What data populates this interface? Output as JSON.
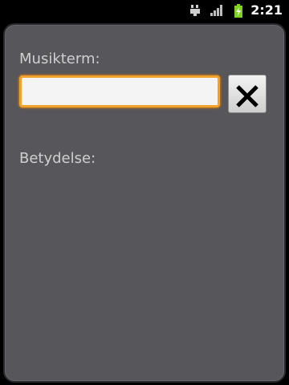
{
  "status_bar": {
    "time": "2:21",
    "icons": [
      "usb-debug-icon",
      "signal-icon",
      "battery-charging-icon"
    ]
  },
  "form": {
    "term_label": "Musikterm:",
    "term_value": "",
    "clear_icon": "close-icon",
    "meaning_label": "Betydelse:"
  },
  "colors": {
    "panel_bg": "#57565a",
    "input_focus_border": "#f0a22a",
    "label_text": "#cfcfcf",
    "battery": "#7ed321"
  }
}
